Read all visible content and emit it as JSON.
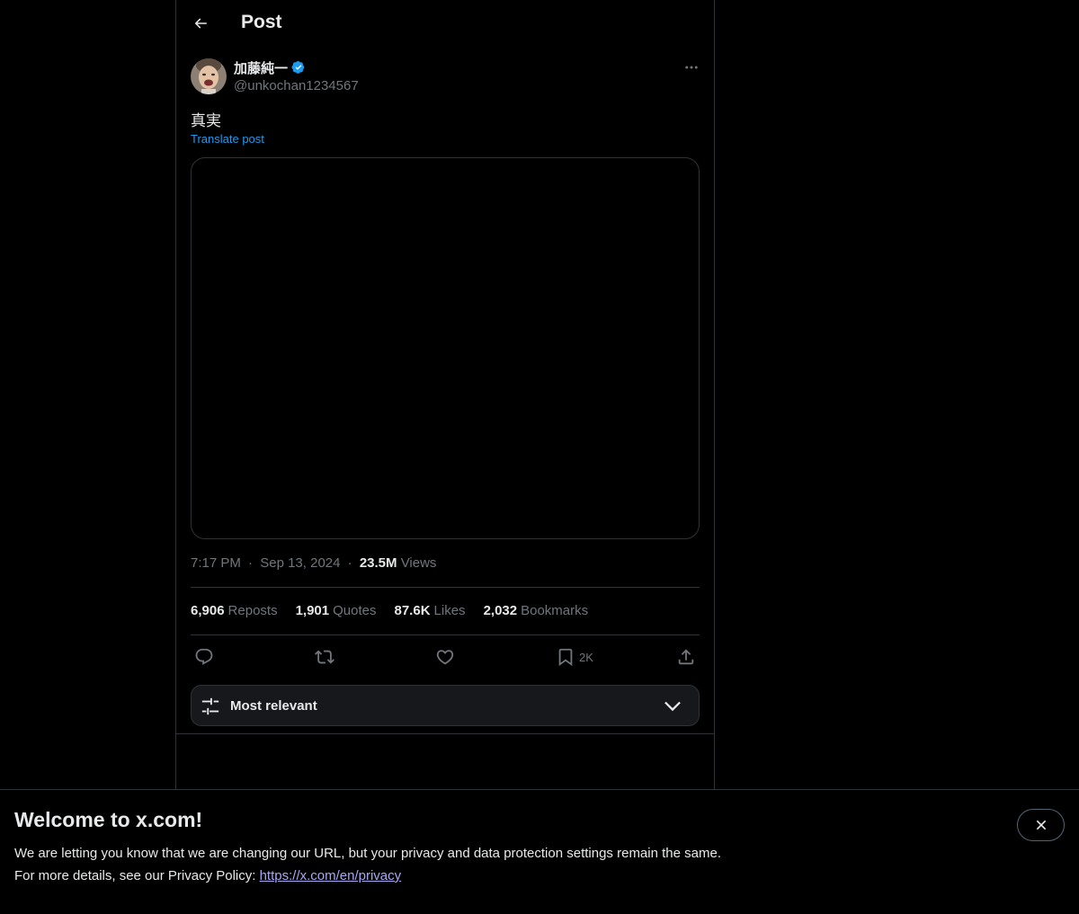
{
  "header": {
    "title": "Post",
    "back_icon": "arrow-left-icon"
  },
  "author": {
    "name": "加藤純一",
    "handle": "@unkochan1234567",
    "verified": true,
    "verified_color": "#1d9bf0"
  },
  "post": {
    "text": "真実",
    "translate_label": "Translate post",
    "time": "7:17 PM",
    "date": "Sep 13, 2024",
    "views_count": "23.5M",
    "views_label": "Views"
  },
  "stats": {
    "reposts_count": "6,906",
    "reposts_label": "Reposts",
    "quotes_count": "1,901",
    "quotes_label": "Quotes",
    "likes_count": "87.6K",
    "likes_label": "Likes",
    "bookmarks_count": "2,032",
    "bookmarks_label": "Bookmarks"
  },
  "actions": {
    "reply_icon": "reply-icon",
    "repost_icon": "repost-icon",
    "like_icon": "heart-icon",
    "bookmark_icon": "bookmark-icon",
    "bookmark_count": "2K",
    "share_icon": "share-icon"
  },
  "sort": {
    "label": "Most relevant",
    "icon": "sliders-icon",
    "chevron": "chevron-down-icon"
  },
  "banner": {
    "title": "Welcome to x.com!",
    "line1": "We are letting you know that we are changing our URL, but your privacy and data protection settings remain the same.",
    "line2_prefix": "For more details, see our Privacy Policy: ",
    "link": "https://x.com/en/privacy",
    "close_icon": "close-icon"
  },
  "colors": {
    "background": "#000000",
    "text": "#e7e9ea",
    "muted": "#71767b",
    "accent": "#1d9bf0",
    "border": "#2f3336"
  }
}
